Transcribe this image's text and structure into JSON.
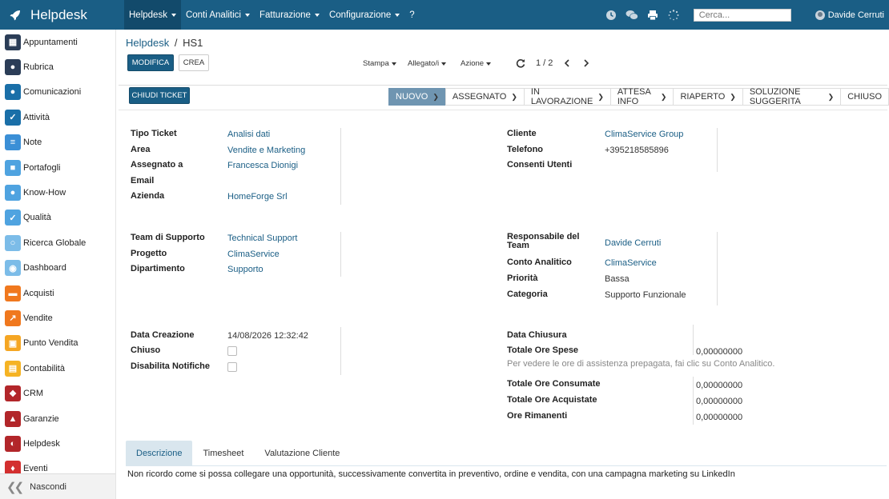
{
  "brand": {
    "name": "Helpdesk"
  },
  "topnav": {
    "items": [
      {
        "label": "Helpdesk"
      },
      {
        "label": "Conti Analitici"
      },
      {
        "label": "Fatturazione"
      },
      {
        "label": "Configurazione"
      },
      {
        "label": "?"
      }
    ]
  },
  "search": {
    "placeholder": "Cerca..."
  },
  "user": {
    "name": "Davide Cerruti"
  },
  "sidebar": {
    "items": [
      {
        "label": "Appuntamenti",
        "icon": "calendar-icon",
        "color": "#2b3d57"
      },
      {
        "label": "Rubrica",
        "icon": "contacts-icon",
        "color": "#2b3d57"
      },
      {
        "label": "Comunicazioni",
        "icon": "chat-icon",
        "color": "#1a6fa8"
      },
      {
        "label": "Attività",
        "icon": "check-icon",
        "color": "#1a6fa8"
      },
      {
        "label": "Note",
        "icon": "note-icon",
        "color": "#3b8fd6"
      },
      {
        "label": "Portafogli",
        "icon": "lock-icon",
        "color": "#4fa3e0"
      },
      {
        "label": "Know-How",
        "icon": "head-icon",
        "color": "#4fa3e0"
      },
      {
        "label": "Qualità",
        "icon": "quality-icon",
        "color": "#4fa3e0"
      },
      {
        "label": "Ricerca Globale",
        "icon": "search-icon",
        "color": "#7cbce8"
      },
      {
        "label": "Dashboard",
        "icon": "dashboard-icon",
        "color": "#7cbce8"
      },
      {
        "label": "Acquisti",
        "icon": "purchase-icon",
        "color": "#f0781e"
      },
      {
        "label": "Vendite",
        "icon": "sales-icon",
        "color": "#f0781e"
      },
      {
        "label": "Punto Vendita",
        "icon": "pos-icon",
        "color": "#f5a623"
      },
      {
        "label": "Contabilità",
        "icon": "accounting-icon",
        "color": "#f5b323"
      },
      {
        "label": "CRM",
        "icon": "crm-icon",
        "color": "#b2262a"
      },
      {
        "label": "Garanzie",
        "icon": "shield-icon",
        "color": "#b2262a"
      },
      {
        "label": "Helpdesk",
        "icon": "headset-icon",
        "color": "#b2262a"
      },
      {
        "label": "Eventi",
        "icon": "event-icon",
        "color": "#d32f2f"
      }
    ],
    "hide_label": "Nascondi"
  },
  "breadcrumb": {
    "parent": "Helpdesk",
    "separator": "/",
    "current": "HS1"
  },
  "actions": {
    "edit_label": "MODIFICA",
    "create_label": "CREA",
    "close_ticket_label": "CHIUDI TICKET"
  },
  "toolbar": {
    "print": "Stampa",
    "attachments": "Allegato/i",
    "action": "Azione"
  },
  "pager": {
    "value": "1 / 2"
  },
  "status": {
    "steps": [
      "NUOVO",
      "ASSEGNATO",
      "IN LAVORAZIONE",
      "ATTESA INFO",
      "RIAPERTO",
      "SOLUZIONE SUGGERITA",
      "CHIUSO"
    ],
    "current": "NUOVO"
  },
  "form": {
    "ticket_type": {
      "label": "Tipo Ticket",
      "value": "Analisi dati"
    },
    "area": {
      "label": "Area",
      "value": "Vendite e Marketing"
    },
    "assigned_to": {
      "label": "Assegnato a",
      "value": "Francesca Dionigi"
    },
    "email": {
      "label": "Email",
      "value": ""
    },
    "company": {
      "label": "Azienda",
      "value": "HomeForge Srl"
    },
    "customer": {
      "label": "Cliente",
      "value": "ClimaService Group"
    },
    "phone": {
      "label": "Telefono",
      "value": "+395218585896"
    },
    "user_consent": {
      "label": "Consenti Utenti",
      "value": ""
    },
    "support_team": {
      "label": "Team di Supporto",
      "value": "Technical Support"
    },
    "project": {
      "label": "Progetto",
      "value": "ClimaService"
    },
    "department": {
      "label": "Dipartimento",
      "value": "Supporto"
    },
    "team_lead": {
      "label": "Responsabile del Team",
      "value": "Davide Cerruti"
    },
    "analytic_account": {
      "label": "Conto Analitico",
      "value": "ClimaService"
    },
    "priority": {
      "label": "Priorità",
      "value": "Bassa"
    },
    "category": {
      "label": "Categoria",
      "value": "Supporto Funzionale"
    },
    "creation_date": {
      "label": "Data Creazione",
      "value": "14/08/2026 12:32:42"
    },
    "closed": {
      "label": "Chiuso"
    },
    "disable_notifications": {
      "label": "Disabilita Notifiche"
    },
    "closing_date": {
      "label": "Data Chiusura",
      "value": ""
    },
    "hours_spent": {
      "label": "Totale Ore Spese",
      "value": "0,00000000"
    },
    "prepaid_hint": "Per vedere le ore di assistenza prepagata, fai clic su Conto Analitico.",
    "hours_consumed": {
      "label": "Totale Ore Consumate",
      "value": "0,00000000"
    },
    "hours_purchased": {
      "label": "Totale Ore Acquistate",
      "value": "0,00000000"
    },
    "hours_remaining": {
      "label": "Ore Rimanenti",
      "value": "0,00000000"
    }
  },
  "tabs": [
    "Descrizione",
    "Timesheet",
    "Valutazione Cliente"
  ],
  "description": "Non ricordo come si possa collegare una opportunità, successivamente convertita in preventivo, ordine e vendita, con una campagna marketing su LinkedIn"
}
